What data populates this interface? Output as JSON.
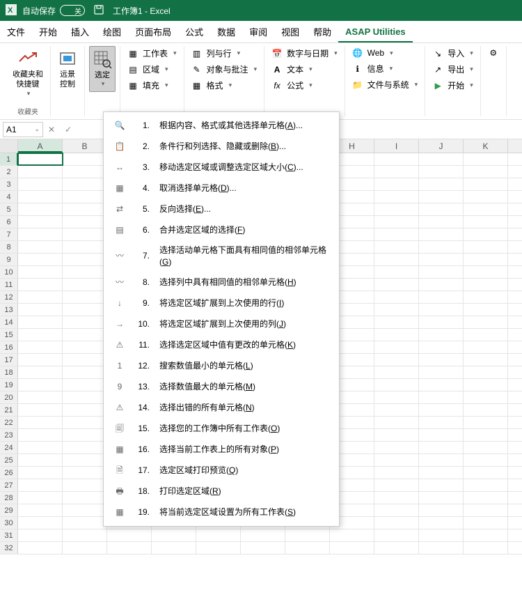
{
  "title_bar": {
    "autosave_label": "自动保存",
    "autosave_state": "关",
    "doc_title": "工作簿1 - Excel"
  },
  "tabs": [
    "文件",
    "开始",
    "插入",
    "绘图",
    "页面布局",
    "公式",
    "数据",
    "审阅",
    "视图",
    "帮助",
    "ASAP Utilities"
  ],
  "active_tab": 10,
  "ribbon": {
    "fav": {
      "label": "收藏夹和\n快捷键",
      "group": "收藏夹"
    },
    "vision": "远景\n控制",
    "select": "选定",
    "col1": [
      "工作表",
      "区域",
      "填充"
    ],
    "col2": [
      "列与行",
      "对象与批注",
      "格式"
    ],
    "col3": [
      "数字与日期",
      "文本",
      "公式"
    ],
    "col4": [
      "Web",
      "信息",
      "文件与系统"
    ],
    "col5": [
      "导入",
      "导出",
      "开始"
    ]
  },
  "name_box": "A1",
  "columns": [
    "A",
    "B",
    "C",
    "D",
    "E",
    "F",
    "G",
    "H",
    "I",
    "J",
    "K"
  ],
  "menu": [
    {
      "n": "1.",
      "t": "根据内容、格式或其他选择单元格(",
      "k": "A",
      "s": ")..."
    },
    {
      "n": "2.",
      "t": "条件行和列选择、隐藏或删除(",
      "k": "B",
      "s": ")..."
    },
    {
      "n": "3.",
      "t": "移动选定区域或调整选定区域大小(",
      "k": "C",
      "s": ")..."
    },
    {
      "n": "4.",
      "t": "取消选择单元格(",
      "k": "D",
      "s": ")..."
    },
    {
      "n": "5.",
      "t": "反向选择(",
      "k": "E",
      "s": ")..."
    },
    {
      "n": "6.",
      "t": "合并选定区域的选择(",
      "k": "F",
      "s": ")"
    },
    {
      "n": "7.",
      "t": "选择活动单元格下面具有相同值的相邻单元格(",
      "k": "G",
      "s": ")"
    },
    {
      "n": "8.",
      "t": "选择列中具有相同值的相邻单元格(",
      "k": "H",
      "s": ")"
    },
    {
      "n": "9.",
      "t": "将选定区域扩展到上次使用的行(",
      "k": "I",
      "s": ")"
    },
    {
      "n": "10.",
      "t": "将选定区域扩展到上次使用的列(",
      "k": "J",
      "s": ")"
    },
    {
      "n": "11.",
      "t": "选择选定区域中值有更改的单元格(",
      "k": "K",
      "s": ")"
    },
    {
      "n": "12.",
      "t": "搜索数值最小的单元格(",
      "k": "L",
      "s": ")"
    },
    {
      "n": "13.",
      "t": "选择数值最大的单元格(",
      "k": "M",
      "s": ")"
    },
    {
      "n": "14.",
      "t": "选择出错的所有单元格(",
      "k": "N",
      "s": ")"
    },
    {
      "n": "15.",
      "t": "选择您的工作簿中所有工作表(",
      "k": "O",
      "s": ")"
    },
    {
      "n": "16.",
      "t": "选择当前工作表上的所有对象(",
      "k": "P",
      "s": ")"
    },
    {
      "n": "17.",
      "t": "选定区域打印预览(",
      "k": "Q",
      "s": ")"
    },
    {
      "n": "18.",
      "t": "打印选定区域(",
      "k": "R",
      "s": ")"
    },
    {
      "n": "19.",
      "t": "将当前选定区域设置为所有工作表(",
      "k": "S",
      "s": ")"
    }
  ],
  "menu_icons": [
    "🔍",
    "📋",
    "↔",
    "▦",
    "⇄",
    "▤",
    "〰",
    "〰",
    "↓",
    "→",
    "⚠",
    "1",
    "9",
    "⚠",
    "🗐",
    "▦",
    "🗎",
    "🖶",
    "▦"
  ]
}
